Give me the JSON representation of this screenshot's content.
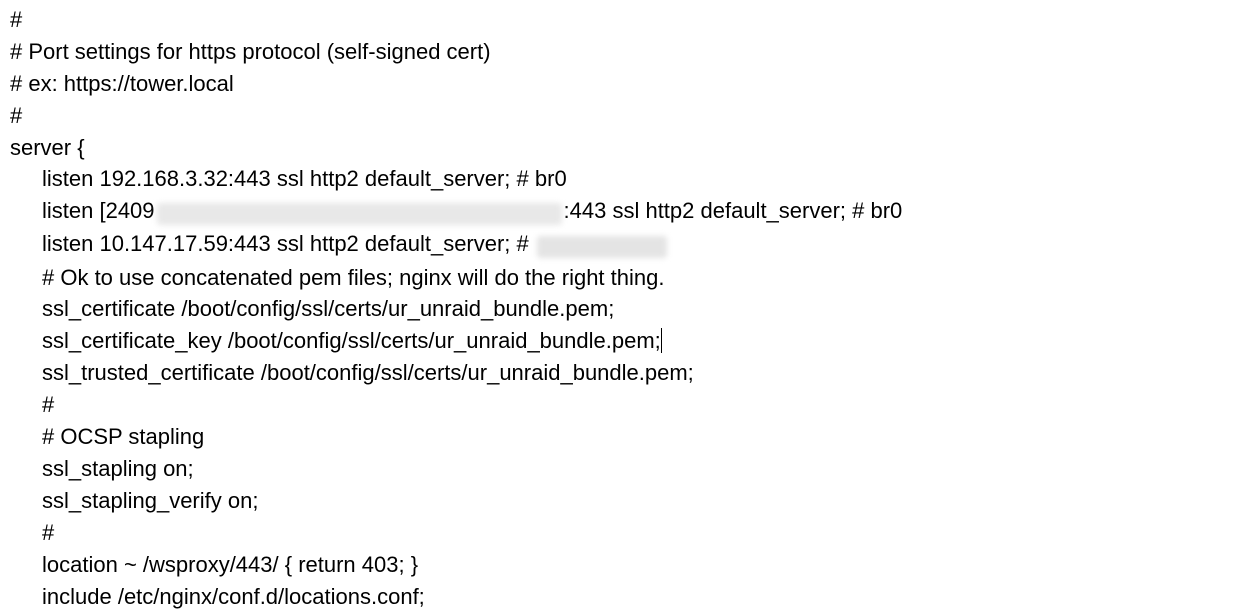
{
  "lines": {
    "l1": "#",
    "l2": "# Port settings for https protocol (self-signed cert)",
    "l3": "# ex: https://tower.local",
    "l4": "#",
    "l5": "server {",
    "l6": "listen 192.168.3.32:443 ssl http2 default_server; # br0",
    "l7a": "listen [2409",
    "l7b": ":443 ssl http2 default_server; # br0",
    "l8a": "listen 10.147.17.59:443 ssl http2 default_server; # ",
    "l9": "# Ok to use concatenated pem files; nginx will do the right thing.",
    "l10": "ssl_certificate         /boot/config/ssl/certs/ur_unraid_bundle.pem;",
    "l11": "ssl_certificate_key     /boot/config/ssl/certs/ur_unraid_bundle.pem;",
    "l12": "ssl_trusted_certificate /boot/config/ssl/certs/ur_unraid_bundle.pem;",
    "l13": "#",
    "l14": "# OCSP stapling",
    "l15": "ssl_stapling on;",
    "l16": "ssl_stapling_verify on;",
    "l17": "#",
    "l18": "location ~ /wsproxy/443/ { return 403; }",
    "l19": "include /etc/nginx/conf.d/locations.conf;"
  }
}
